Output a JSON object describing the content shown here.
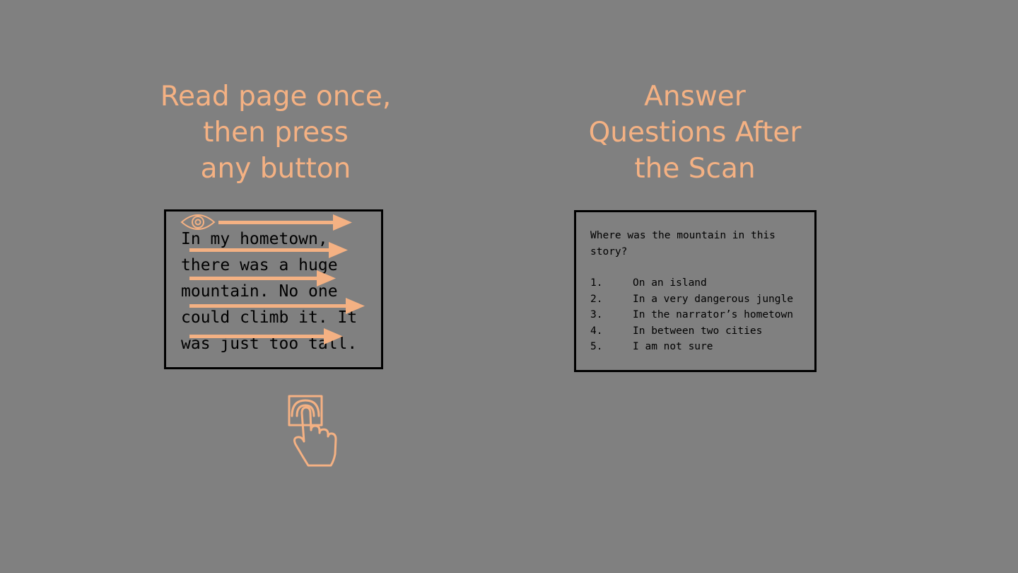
{
  "left_panel": {
    "title_lines": [
      "Read page once,",
      "then press",
      "any button"
    ],
    "passage_lines": [
      "In my hometown,",
      "there was a huge",
      "mountain. No one",
      "could climb it. It",
      "was just too tall."
    ],
    "icons": [
      "eye-icon",
      "arrow-icon",
      "finger-press-button-icon"
    ]
  },
  "right_panel": {
    "title_lines": [
      "Answer",
      "Questions After",
      "the Scan"
    ],
    "question": "Where was the mountain in this story?",
    "options": [
      {
        "num": "1.",
        "text": "On an island"
      },
      {
        "num": "2.",
        "text": "In a very dangerous jungle"
      },
      {
        "num": "3.",
        "text": "In the narrator’s hometown"
      },
      {
        "num": "4.",
        "text": "In between two cities"
      },
      {
        "num": "5.",
        "text": "I am not sure"
      }
    ]
  },
  "colors": {
    "background": "#808080",
    "accent": "#f4b183",
    "border": "#000000"
  }
}
